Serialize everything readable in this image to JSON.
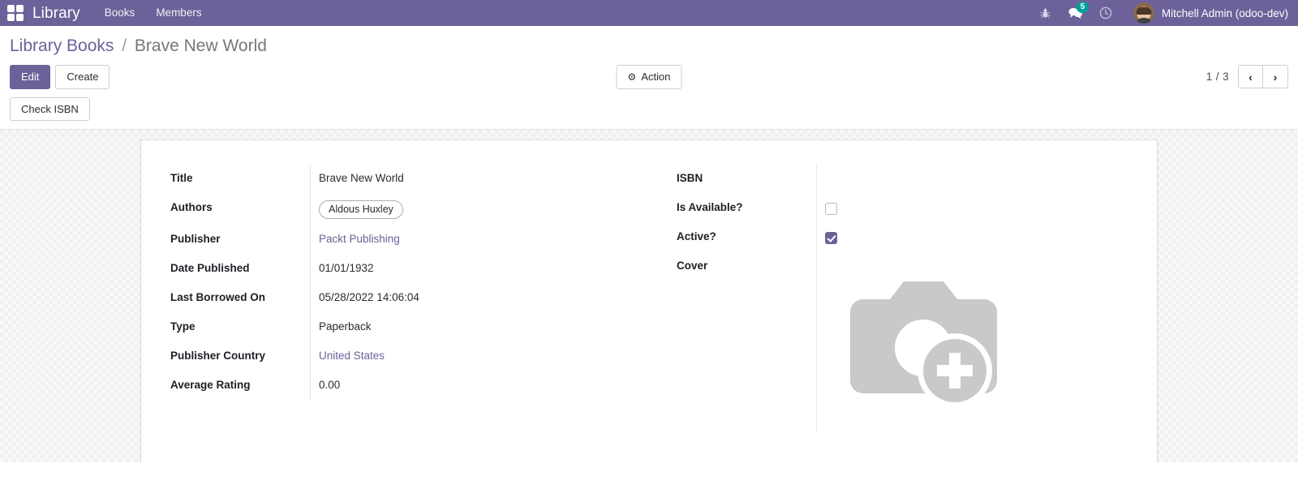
{
  "navbar": {
    "apps_icon": "apps-grid-icon",
    "brand": "Library",
    "menu": [
      {
        "label": "Books"
      },
      {
        "label": "Members"
      }
    ],
    "icons": [
      {
        "name": "bug-icon",
        "glyph": "bug"
      },
      {
        "name": "messages-icon",
        "glyph": "chat",
        "badge": "5"
      },
      {
        "name": "activity-clock-icon",
        "glyph": "clock"
      }
    ],
    "user": {
      "name": "Mitchell Admin (odoo-dev)",
      "avatar": "user-avatar"
    },
    "bg_color": "#6c6199"
  },
  "breadcrumb": {
    "root": "Library Books",
    "separator": "/",
    "current": "Brave New World"
  },
  "control_panel": {
    "edit_label": "Edit",
    "create_label": "Create",
    "action_label": "Action",
    "action_icon": "gear-icon",
    "pager": {
      "count": "1 / 3",
      "prev": "‹",
      "next": "›"
    }
  },
  "statusbar": {
    "check_isbn_label": "Check ISBN"
  },
  "form": {
    "left_fields": [
      {
        "label": "Title",
        "value": "Brave New World",
        "type": "text"
      },
      {
        "label": "Authors",
        "value": "Aldous Huxley",
        "type": "tag"
      },
      {
        "label": "Publisher",
        "value": "Packt Publishing",
        "type": "link"
      },
      {
        "label": "Date Published",
        "value": "01/01/1932",
        "type": "text"
      },
      {
        "label": "Last Borrowed On",
        "value": "05/28/2022 14:06:04",
        "type": "text"
      },
      {
        "label": "Type",
        "value": "Paperback",
        "type": "text"
      },
      {
        "label": "Publisher Country",
        "value": "United States",
        "type": "link"
      },
      {
        "label": "Average Rating",
        "value": "0.00",
        "type": "text"
      }
    ],
    "right_fields": [
      {
        "label": "ISBN",
        "value": "",
        "type": "text"
      },
      {
        "label": "Is Available?",
        "value": "",
        "type": "checkbox",
        "checked": false
      },
      {
        "label": "Active?",
        "value": "",
        "type": "checkbox",
        "checked": true
      },
      {
        "label": "Cover",
        "value": "",
        "type": "image"
      }
    ],
    "cover_placeholder_icon": "camera-add-placeholder-icon"
  },
  "colors": {
    "accent": "#6c6199",
    "badge": "#00a09d",
    "link": "#6c6199",
    "placeholder_gray": "#c9c9c9"
  }
}
